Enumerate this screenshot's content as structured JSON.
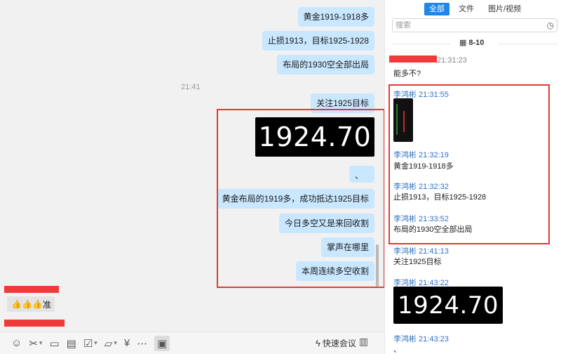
{
  "chat": {
    "messages": [
      {
        "text": "黄金1919-1918多"
      },
      {
        "text": "止损1913，目标1925-1928"
      },
      {
        "text": "布局的1930空全部出局"
      },
      {
        "text": "关注1925目标"
      },
      {
        "text": "、"
      },
      {
        "text": "黄金布局的1919多，成功抵达1925目标"
      },
      {
        "text": "今日多空又是来回收割"
      },
      {
        "text": "掌声在哪里"
      },
      {
        "text": "本周连续多空收割"
      }
    ],
    "timestamp": "21:41",
    "price_image_text": "1924.70",
    "reaction": {
      "emoji": "👍👍👍",
      "text": "准"
    }
  },
  "toolbar": {
    "icons": [
      "emoji-icon",
      "scissors-icon",
      "image-icon",
      "document-icon",
      "checkbox-icon",
      "folder-icon",
      "yen-icon",
      "more-icon",
      "screen-share-icon"
    ],
    "quick_meeting_label": "快速会议"
  },
  "history": {
    "tabs": [
      {
        "label": "全部",
        "active": true
      },
      {
        "label": "文件",
        "active": false
      },
      {
        "label": "图片/视频",
        "active": false
      }
    ],
    "search_placeholder": "搜索",
    "date_label": "8-10",
    "first_time": "21:31:23",
    "first_text": "能多不?",
    "entries": [
      {
        "sender": "李鸿彬 21:31:55"
      },
      {
        "sender": "李鸿彬 21:32:19",
        "text": "黄金1919-1918多"
      },
      {
        "sender": "李鸿彬 21:32:32",
        "text": "止损1913，目标1925-1928"
      },
      {
        "sender": "李鸿彬 21:33:52",
        "text": "布局的1930空全部出局"
      },
      {
        "sender": "李鸿彬 21:41:13",
        "text": "关注1925目标"
      },
      {
        "sender": "李鸿彬 21:43:22"
      },
      {
        "sender": "李鸿彬 21:43:23",
        "text": "、"
      }
    ],
    "price_image_text": "1924.70"
  },
  "colors": {
    "bubble": "#c9e7ff",
    "accent": "#1e88e5",
    "sender": "#2e72c2",
    "highlight": "#e53935"
  }
}
